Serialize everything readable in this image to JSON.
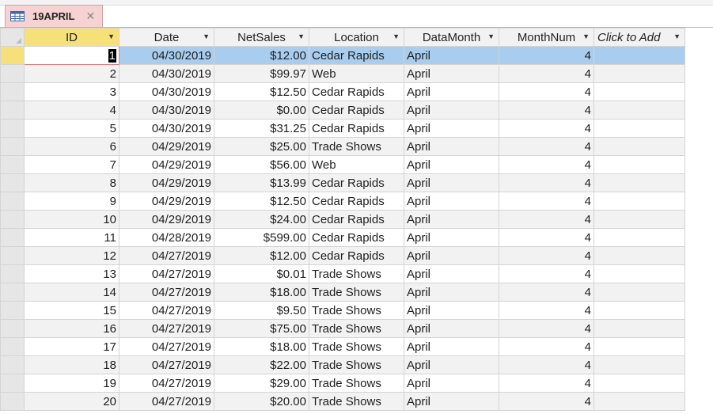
{
  "tab": {
    "title": "19APRIL",
    "close_icon": "close-icon",
    "table_icon": "table-icon"
  },
  "columns": [
    {
      "key": "id",
      "label": "ID"
    },
    {
      "key": "date",
      "label": "Date"
    },
    {
      "key": "netsales",
      "label": "NetSales"
    },
    {
      "key": "location",
      "label": "Location"
    },
    {
      "key": "datamonth",
      "label": "DataMonth"
    },
    {
      "key": "monthnum",
      "label": "MonthNum"
    },
    {
      "key": "add",
      "label": "Click to Add"
    }
  ],
  "rows": [
    {
      "id": "1",
      "date": "04/30/2019",
      "netsales": "$12.00",
      "location": "Cedar Rapids",
      "datamonth": "April",
      "monthnum": "4"
    },
    {
      "id": "2",
      "date": "04/30/2019",
      "netsales": "$99.97",
      "location": "Web",
      "datamonth": "April",
      "monthnum": "4"
    },
    {
      "id": "3",
      "date": "04/30/2019",
      "netsales": "$12.50",
      "location": "Cedar Rapids",
      "datamonth": "April",
      "monthnum": "4"
    },
    {
      "id": "4",
      "date": "04/30/2019",
      "netsales": "$0.00",
      "location": "Cedar Rapids",
      "datamonth": "April",
      "monthnum": "4"
    },
    {
      "id": "5",
      "date": "04/30/2019",
      "netsales": "$31.25",
      "location": "Cedar Rapids",
      "datamonth": "April",
      "monthnum": "4"
    },
    {
      "id": "6",
      "date": "04/29/2019",
      "netsales": "$25.00",
      "location": "Trade Shows",
      "datamonth": "April",
      "monthnum": "4"
    },
    {
      "id": "7",
      "date": "04/29/2019",
      "netsales": "$56.00",
      "location": "Web",
      "datamonth": "April",
      "monthnum": "4"
    },
    {
      "id": "8",
      "date": "04/29/2019",
      "netsales": "$13.99",
      "location": "Cedar Rapids",
      "datamonth": "April",
      "monthnum": "4"
    },
    {
      "id": "9",
      "date": "04/29/2019",
      "netsales": "$12.50",
      "location": "Cedar Rapids",
      "datamonth": "April",
      "monthnum": "4"
    },
    {
      "id": "10",
      "date": "04/29/2019",
      "netsales": "$24.00",
      "location": "Cedar Rapids",
      "datamonth": "April",
      "monthnum": "4"
    },
    {
      "id": "11",
      "date": "04/28/2019",
      "netsales": "$599.00",
      "location": "Cedar Rapids",
      "datamonth": "April",
      "monthnum": "4"
    },
    {
      "id": "12",
      "date": "04/27/2019",
      "netsales": "$12.00",
      "location": "Cedar Rapids",
      "datamonth": "April",
      "monthnum": "4"
    },
    {
      "id": "13",
      "date": "04/27/2019",
      "netsales": "$0.01",
      "location": "Trade Shows",
      "datamonth": "April",
      "monthnum": "4"
    },
    {
      "id": "14",
      "date": "04/27/2019",
      "netsales": "$18.00",
      "location": "Trade Shows",
      "datamonth": "April",
      "monthnum": "4"
    },
    {
      "id": "15",
      "date": "04/27/2019",
      "netsales": "$9.50",
      "location": "Trade Shows",
      "datamonth": "April",
      "monthnum": "4"
    },
    {
      "id": "16",
      "date": "04/27/2019",
      "netsales": "$75.00",
      "location": "Trade Shows",
      "datamonth": "April",
      "monthnum": "4"
    },
    {
      "id": "17",
      "date": "04/27/2019",
      "netsales": "$18.00",
      "location": "Trade Shows",
      "datamonth": "April",
      "monthnum": "4"
    },
    {
      "id": "18",
      "date": "04/27/2019",
      "netsales": "$22.00",
      "location": "Trade Shows",
      "datamonth": "April",
      "monthnum": "4"
    },
    {
      "id": "19",
      "date": "04/27/2019",
      "netsales": "$29.00",
      "location": "Trade Shows",
      "datamonth": "April",
      "monthnum": "4"
    },
    {
      "id": "20",
      "date": "04/27/2019",
      "netsales": "$20.00",
      "location": "Trade Shows",
      "datamonth": "April",
      "monthnum": "4"
    }
  ],
  "colors": {
    "tab_bg": "#f6d2d2",
    "selected_row": "#a9cdee",
    "selector_active": "#f5e07a",
    "alt_row": "#f2f2f2"
  }
}
